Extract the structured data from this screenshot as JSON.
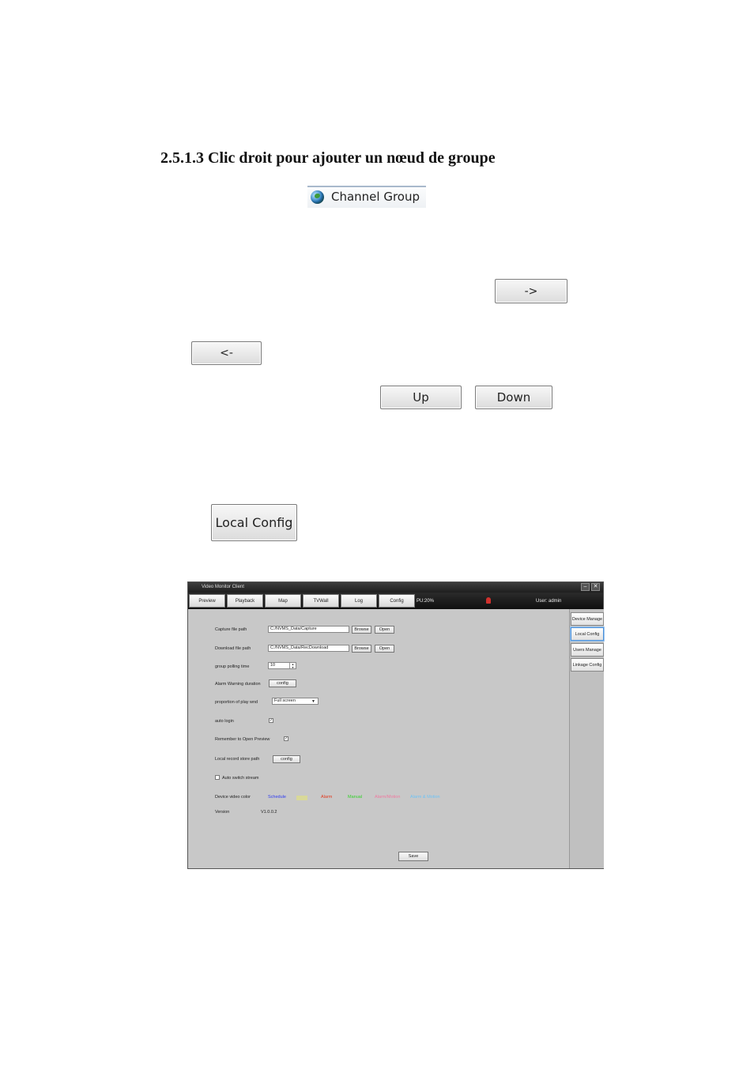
{
  "heading": "2.5.1.3 Clic droit pour ajouter un nœud de groupe",
  "channel_group": {
    "label": "Channel Group",
    "icon": "globe-icon"
  },
  "buttons": {
    "move_right": "->",
    "move_left": "<-",
    "up": "Up",
    "down": "Down",
    "local_config": "Local Config"
  },
  "app": {
    "title": "Video Monitor Client",
    "window_controls": {
      "minimize": "–",
      "close": "✕"
    },
    "tabs": [
      "Preview",
      "Playback",
      "Map",
      "TVWall",
      "Log",
      "Config"
    ],
    "cpu": "PU:20%",
    "user": "User: admin",
    "sidebar": [
      "Device Manage",
      "Local Config",
      "Users Manage",
      "Linkage Config"
    ],
    "sidebar_active": "Local Config",
    "settings": {
      "capture_label": "Capture file path",
      "capture_value": "C:/NVMS_Data/Capture",
      "download_label": "Download file path",
      "download_value": "C:/NVMS_Data/RecDownload",
      "browse": "Browse",
      "open": "Open",
      "polling_label": "group polling time",
      "polling_value": "10",
      "alarm_label": "Alarm Warning duration",
      "config": "config",
      "proportion_label": "proportion of play wnd",
      "proportion_value": "Full screen",
      "auto_login_label": "auto login",
      "remember_label": "Remember to  Open Preview",
      "record_path_label": "Local record store path",
      "auto_switch_label": "Auto switch stream",
      "color_label": "Device video color",
      "colors": [
        {
          "label": "Schedule",
          "color": "#2f3cf0"
        },
        {
          "label": "Alarm",
          "color": "#e23a1f"
        },
        {
          "label": "Manual",
          "color": "#33d12a"
        },
        {
          "label": "Alarm/Motion",
          "color": "#f07aa0"
        },
        {
          "label": "Alarm & Motion",
          "color": "#6fc3f5"
        }
      ],
      "version_label": "Version",
      "version_value": "V1.0.0.2",
      "save": "Save"
    }
  }
}
